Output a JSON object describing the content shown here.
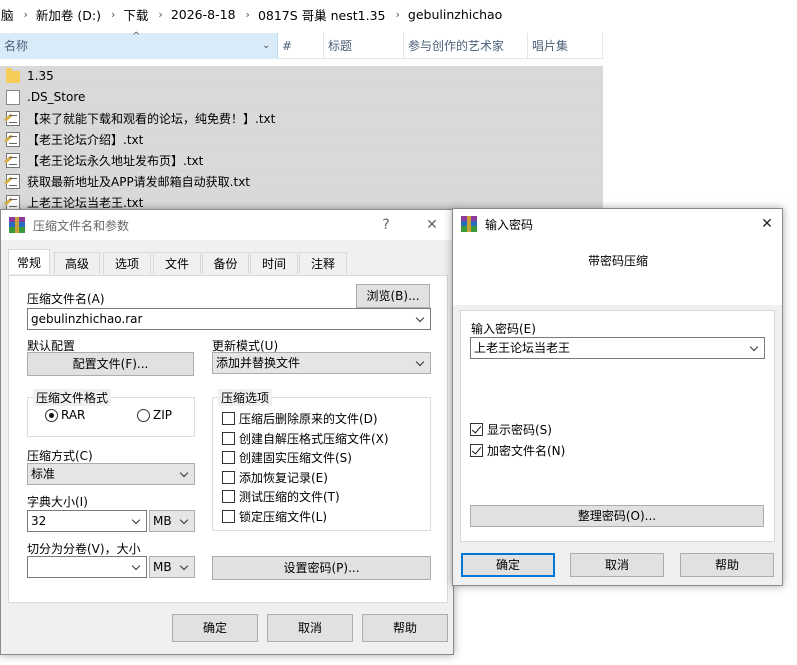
{
  "explorer": {
    "breadcrumb": [
      "脑",
      "新加卷 (D:)",
      "下载",
      "2026-8-18",
      "0817S 哥巢 nest1.35",
      "gebulinzhichao"
    ],
    "columns": [
      "名称",
      "#",
      "标题",
      "参与创作的艺术家",
      "唱片集"
    ],
    "files": [
      {
        "icon": "folder",
        "name": "1.35"
      },
      {
        "icon": "blank",
        "name": ".DS_Store"
      },
      {
        "icon": "txt",
        "name": "【来了就能下载和观看的论坛，纯免费！】.txt"
      },
      {
        "icon": "txt",
        "name": "【老王论坛介绍】.txt"
      },
      {
        "icon": "txt",
        "name": "【老王论坛永久地址发布页】.txt"
      },
      {
        "icon": "txt",
        "name": "获取最新地址及APP请发邮箱自动获取.txt"
      },
      {
        "icon": "txt",
        "name": "上老王论坛当老王.txt"
      }
    ]
  },
  "archive_dialog": {
    "title": "压缩文件名和参数",
    "help_glyph": "?",
    "close_glyph": "✕",
    "tabs": [
      "常规",
      "高级",
      "选项",
      "文件",
      "备份",
      "时间",
      "注释"
    ],
    "archive_name_label": "压缩文件名(A)",
    "browse_label": "浏览(B)...",
    "archive_name_value": "gebulinzhichao.rar",
    "default_profile_label": "默认配置",
    "profiles_button": "配置文件(F)...",
    "update_mode_label": "更新模式(U)",
    "update_mode_value": "添加并替换文件",
    "format_group_label": "压缩文件格式",
    "format_rar": "RAR",
    "format_zip": "ZIP",
    "options_group_label": "压缩选项",
    "options": [
      {
        "label": "压缩后删除原来的文件(D)",
        "checked": false
      },
      {
        "label": "创建自解压格式压缩文件(X)",
        "checked": false
      },
      {
        "label": "创建固实压缩文件(S)",
        "checked": false
      },
      {
        "label": "添加恢复记录(E)",
        "checked": false
      },
      {
        "label": "测试压缩的文件(T)",
        "checked": false
      },
      {
        "label": "锁定压缩文件(L)",
        "checked": false
      }
    ],
    "method_label": "压缩方式(C)",
    "method_value": "标准",
    "dict_label": "字典大小(I)",
    "dict_value": "32",
    "dict_unit": "MB",
    "split_label": "切分为分卷(V)，大小",
    "split_value": "",
    "split_unit": "MB",
    "set_password_button": "设置密码(P)...",
    "ok": "确定",
    "cancel": "取消",
    "help": "帮助"
  },
  "password_dialog": {
    "title": "输入密码",
    "close_glyph": "✕",
    "heading": "带密码压缩",
    "password_label": "输入密码(E)",
    "password_value": "上老王论坛当老王",
    "show_password": {
      "label": "显示密码(S)",
      "checked": true
    },
    "encrypt_names": {
      "label": "加密文件名(N)",
      "checked": true
    },
    "organize_button": "整理密码(O)...",
    "ok": "确定",
    "cancel": "取消",
    "help": "帮助"
  }
}
